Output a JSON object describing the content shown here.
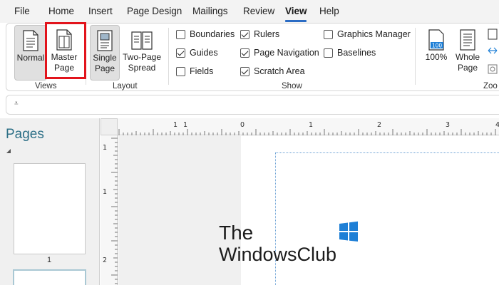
{
  "menu": {
    "items": [
      "File",
      "Home",
      "Insert",
      "Page Design",
      "Mailings",
      "Review",
      "View",
      "Help"
    ],
    "active": "View"
  },
  "ribbon": {
    "views": {
      "label": "Views",
      "normal": "Normal",
      "master_line1": "Master",
      "master_line2": "Page"
    },
    "layout": {
      "label": "Layout",
      "single_line1": "Single",
      "single_line2": "Page",
      "two_line1": "Two-Page",
      "two_line2": "Spread"
    },
    "show": {
      "label": "Show",
      "items": [
        {
          "label": "Boundaries",
          "checked": false
        },
        {
          "label": "Guides",
          "checked": true
        },
        {
          "label": "Fields",
          "checked": false
        },
        {
          "label": "Rulers",
          "checked": true
        },
        {
          "label": "Page Navigation",
          "checked": true
        },
        {
          "label": "Scratch Area",
          "checked": true
        },
        {
          "label": "Graphics Manager",
          "checked": false
        },
        {
          "label": "Baselines",
          "checked": false
        }
      ]
    },
    "zoom": {
      "label": "Zoo",
      "pct_icon_text": "100",
      "pct_label": "100%",
      "whole_line1": "Whole",
      "whole_line2": "Page"
    }
  },
  "pages_pane": {
    "title": "Pages",
    "page_number": "1"
  },
  "ruler": {
    "h_numbers": [
      "1",
      "1",
      "0",
      "1",
      "2",
      "3",
      "4"
    ],
    "v_numbers": [
      "1",
      "1",
      "2"
    ]
  },
  "watermark": {
    "line1": "The",
    "line2": "WindowsClub"
  },
  "colors": {
    "accent": "#2b6cc4",
    "highlight": "#e2141c",
    "pages_title": "#2c6f86",
    "logo_blue": "#1e7fd6"
  }
}
